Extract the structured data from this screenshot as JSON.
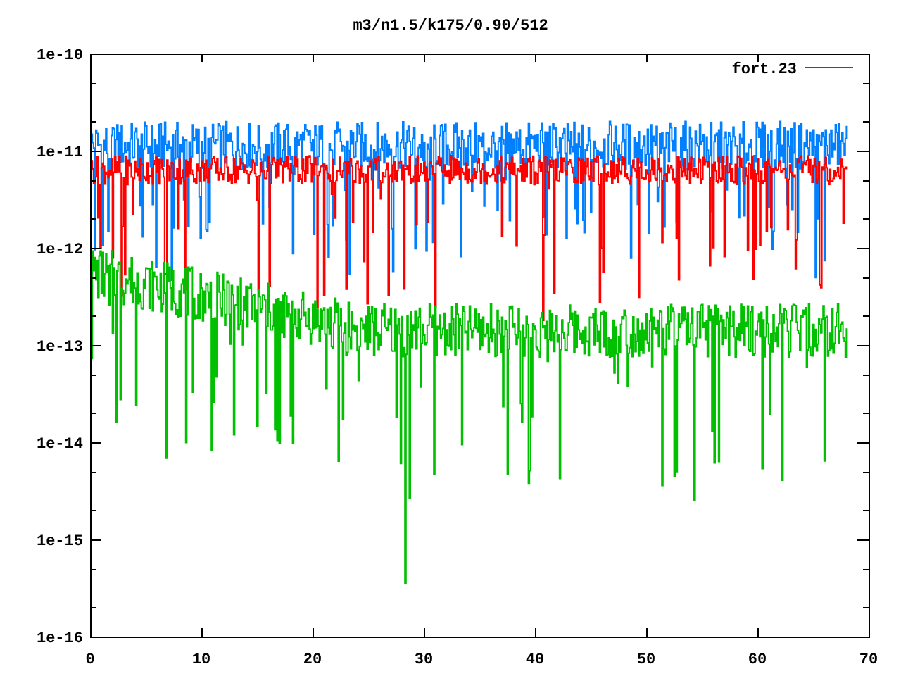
{
  "plot": {
    "title": "m3/n1.5/k175/0.90/512",
    "y_axis_labels": [
      "1e-10",
      "1e-11",
      "1e-12",
      "1e-13",
      "1e-14",
      "1e-15",
      "1e-16"
    ],
    "x_axis_labels": [
      "0",
      "10",
      "20",
      "30",
      "40",
      "50",
      "60",
      "70"
    ],
    "legend": [
      {
        "label": "fort.23",
        "color": "#ff0000"
      }
    ]
  }
}
